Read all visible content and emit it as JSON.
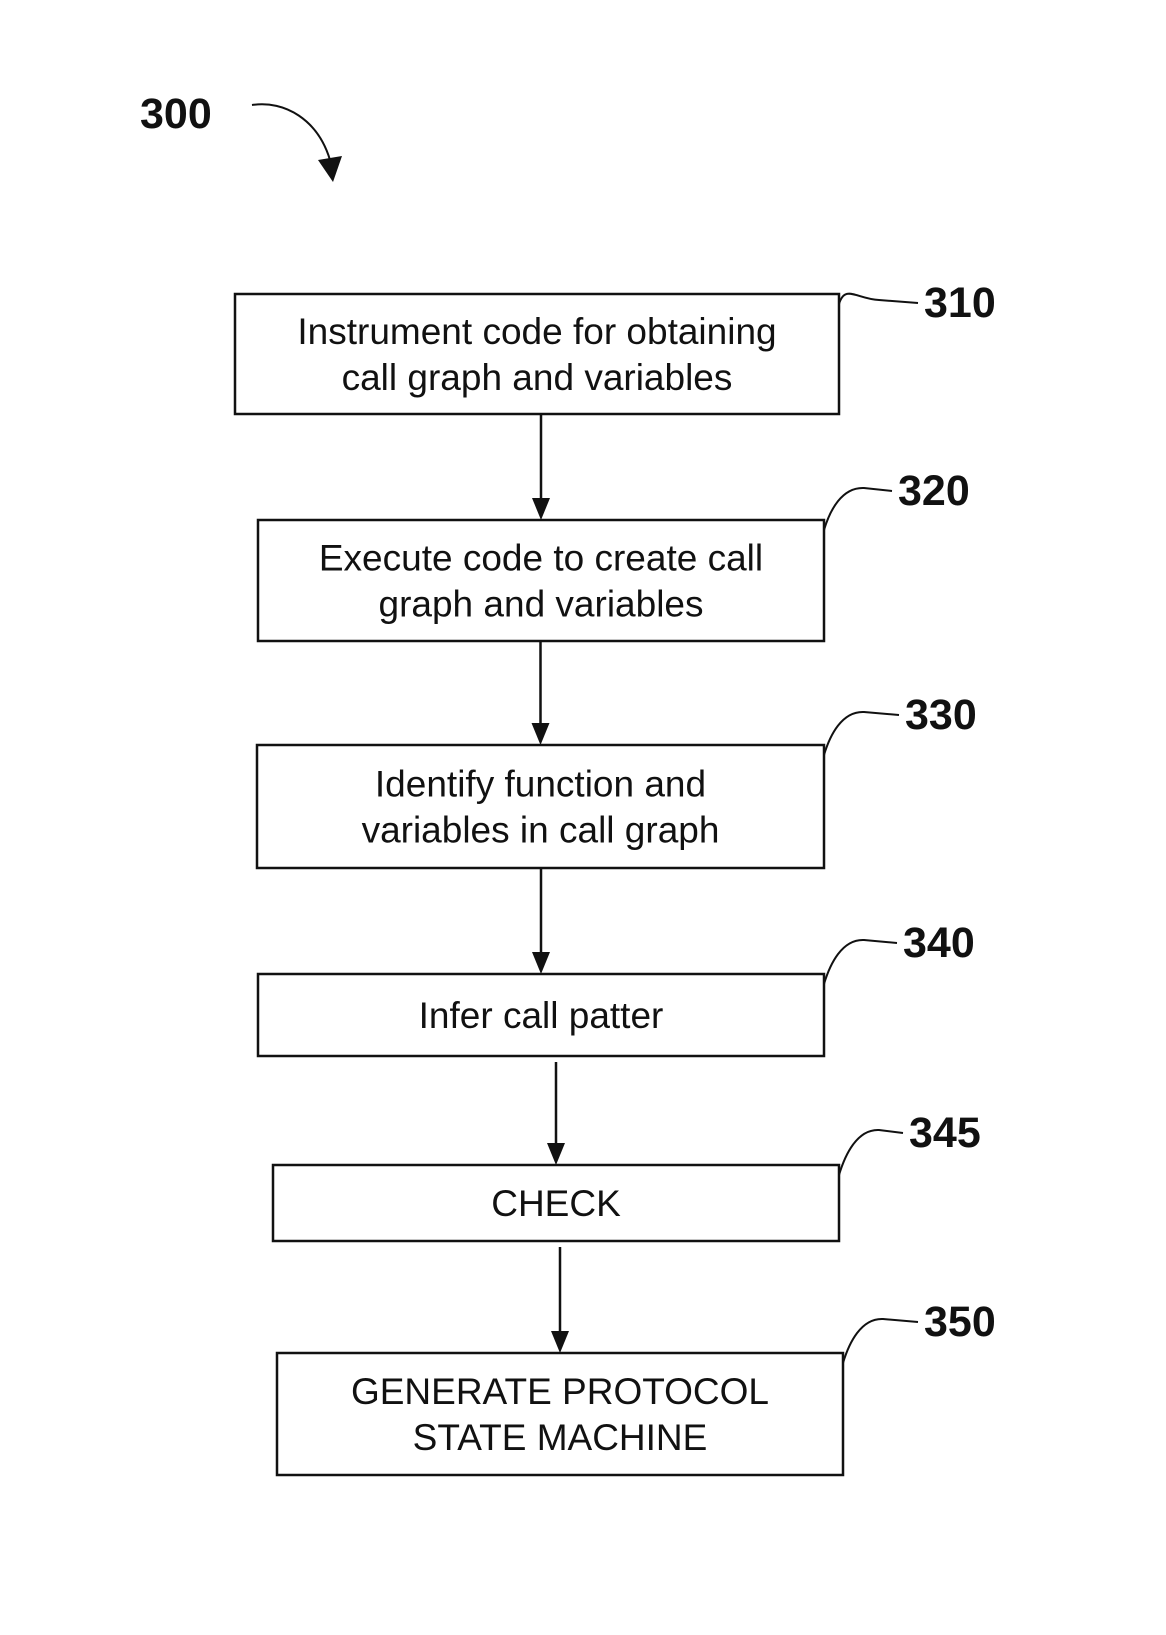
{
  "figure": {
    "ref": "300",
    "steps": [
      {
        "ref": "310",
        "lines": [
          "Instrument code for obtaining",
          "call graph and variables"
        ]
      },
      {
        "ref": "320",
        "lines": [
          "Execute code to create call",
          "graph and variables"
        ]
      },
      {
        "ref": "330",
        "lines": [
          "Identify function and",
          "variables in call graph"
        ]
      },
      {
        "ref": "340",
        "lines": [
          "Infer call patter"
        ]
      },
      {
        "ref": "345",
        "lines": [
          "CHECK"
        ]
      },
      {
        "ref": "350",
        "lines": [
          "GENERATE PROTOCOL",
          "STATE MACHINE"
        ]
      }
    ]
  }
}
